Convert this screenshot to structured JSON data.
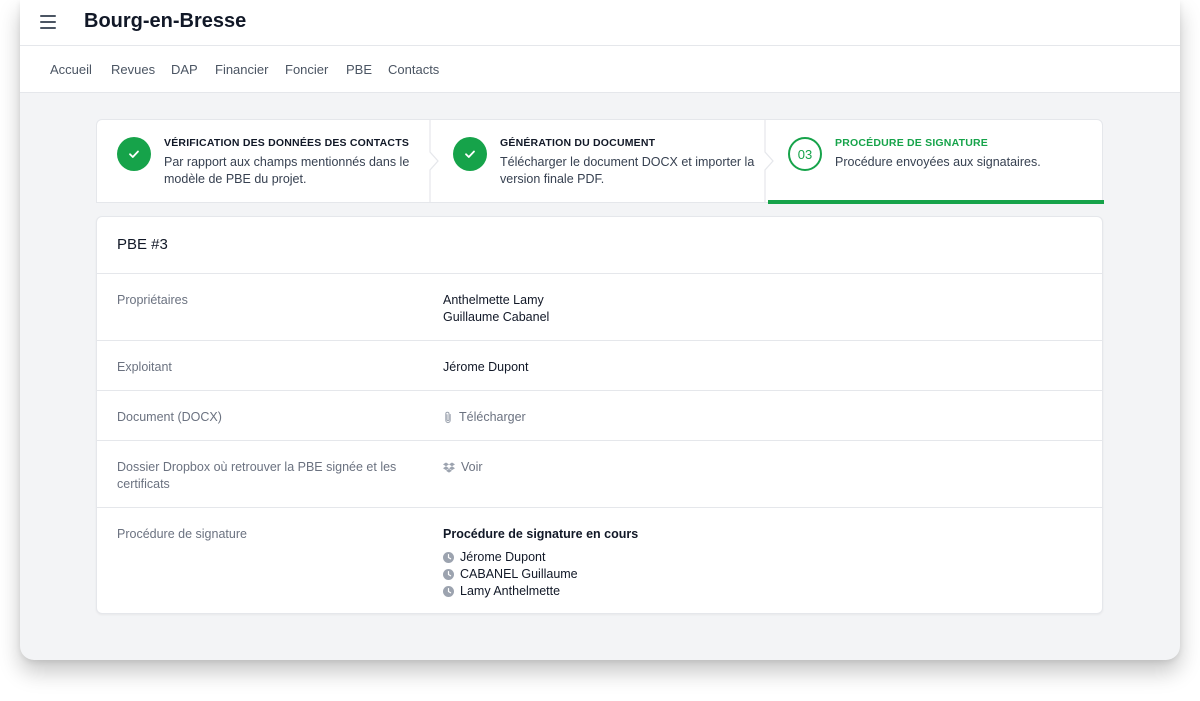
{
  "app": {
    "title": "Bourg-en-Bresse"
  },
  "nav": {
    "items": [
      {
        "id": "accueil",
        "label": "Accueil"
      },
      {
        "id": "revues",
        "label": "Revues"
      },
      {
        "id": "dap",
        "label": "DAP"
      },
      {
        "id": "financier",
        "label": "Financier"
      },
      {
        "id": "foncier",
        "label": "Foncier"
      },
      {
        "id": "pbe",
        "label": "PBE"
      },
      {
        "id": "contacts",
        "label": "Contacts"
      }
    ]
  },
  "steps": [
    {
      "status": "complete",
      "title": "VÉRIFICATION DES DONNÉES DES CONTACTS",
      "description": "Par rapport aux champs mentionnés dans le modèle de PBE du projet."
    },
    {
      "status": "complete",
      "title": "GÉNÉRATION DU DOCUMENT",
      "description": "Télécharger le document DOCX et importer la version finale PDF."
    },
    {
      "status": "current",
      "number": "03",
      "title": "PROCÉDURE DE SIGNATURE",
      "description": "Procédure envoyées aux signataires."
    }
  ],
  "colors": {
    "accent": "#16a34a",
    "muted": "#6b7280"
  },
  "card": {
    "title": "PBE #3",
    "rows": {
      "proprietaires": {
        "label": "Propriétaires",
        "values": [
          "Anthelmette Lamy",
          "Guillaume Cabanel"
        ]
      },
      "exploitant": {
        "label": "Exploitant",
        "value": "Jérome Dupont"
      },
      "document": {
        "label": "Document (DOCX)",
        "link": "Télécharger",
        "icon": "paperclip-icon"
      },
      "dropbox": {
        "label": "Dossier Dropbox où retrouver la PBE signée et les certificats",
        "link": "Voir",
        "icon": "dropbox-icon"
      },
      "signature": {
        "label": "Procédure de signature",
        "status": "Procédure de signature en cours",
        "signers": [
          "Jérome Dupont",
          "CABANEL Guillaume",
          "Lamy Anthelmette"
        ],
        "signer_icon": "clock-icon"
      }
    }
  }
}
